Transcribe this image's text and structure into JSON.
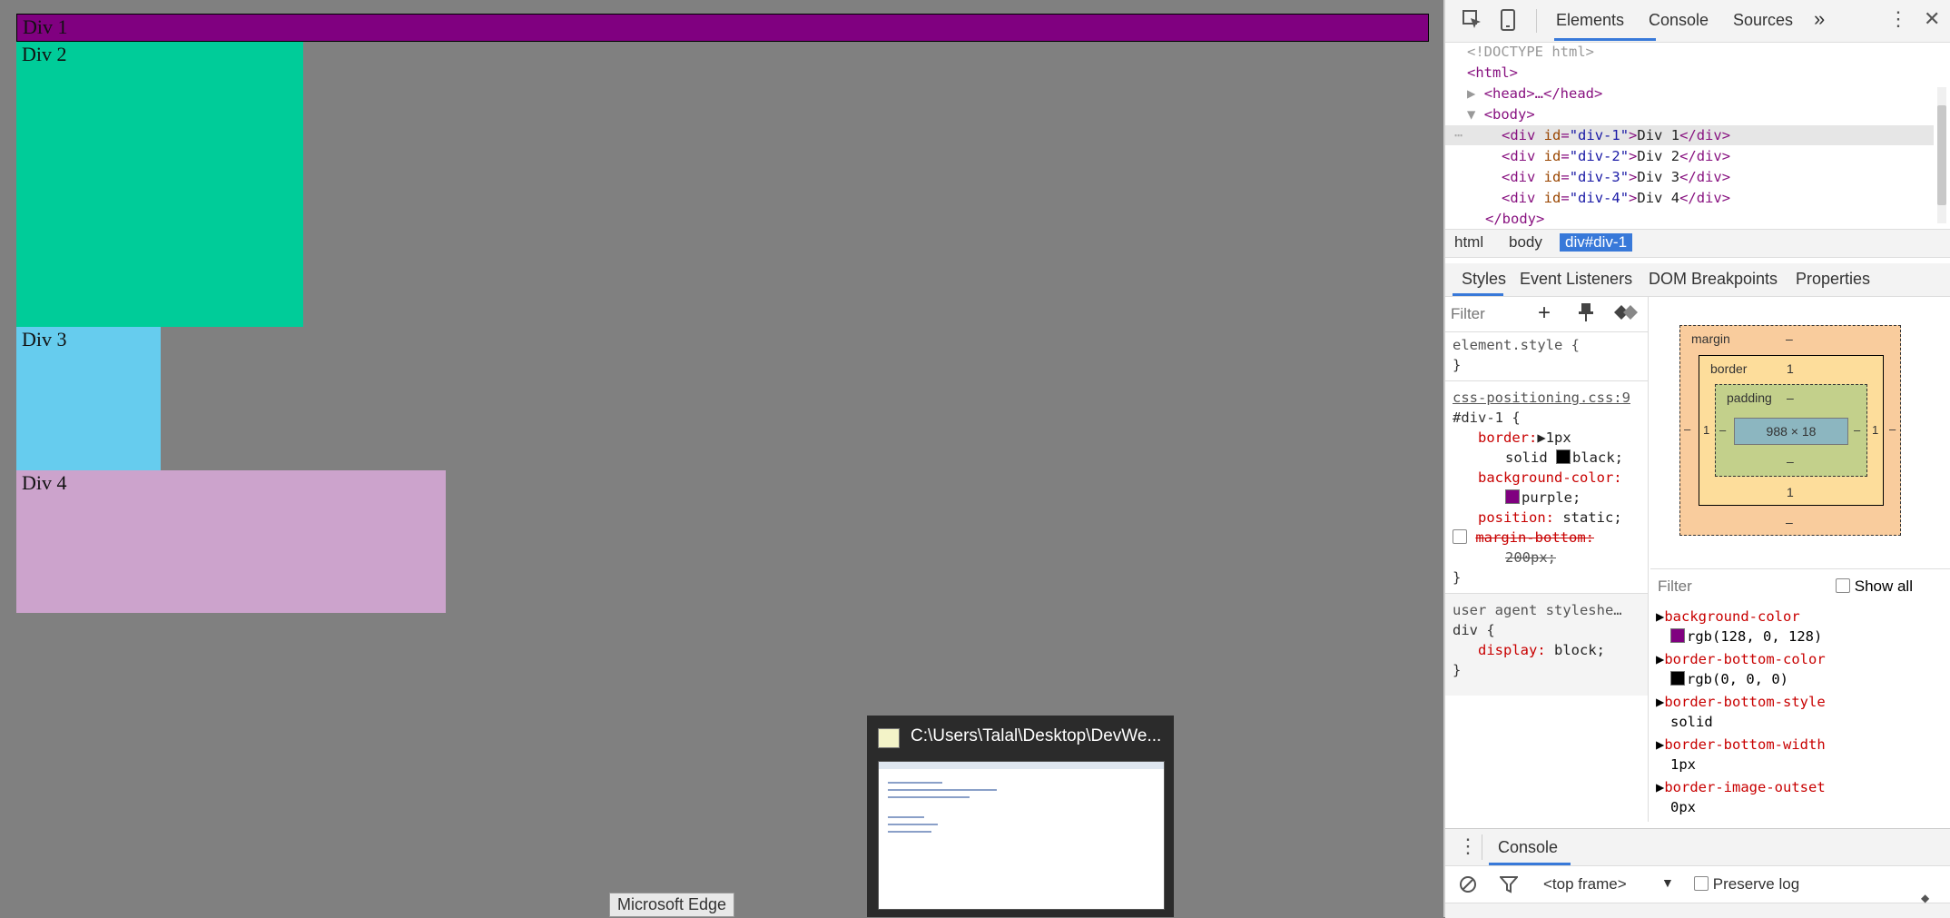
{
  "page": {
    "divs": [
      "Div 1",
      "Div 2",
      "Div 3",
      "Div 4"
    ],
    "taskbar_preview_title": "C:\\Users\\Talal\\Desktop\\DevWe...",
    "tooltip": "Microsoft Edge"
  },
  "devtools": {
    "tabs": [
      "Elements",
      "Console",
      "Sources"
    ],
    "more_tabs": "»",
    "elements_tree": {
      "doctype": "<!DOCTYPE html>",
      "html_open": "<html>",
      "head": "<head>…</head>",
      "body_open": "<body>",
      "divs": [
        {
          "id": "div-1",
          "text": "Div 1"
        },
        {
          "id": "div-2",
          "text": "Div 2"
        },
        {
          "id": "div-3",
          "text": "Div 3"
        },
        {
          "id": "div-4",
          "text": "Div 4"
        }
      ],
      "body_close": "</body>"
    },
    "breadcrumbs": [
      "html",
      "body",
      "div#div-1"
    ],
    "subtabs": [
      "Styles",
      "Event Listeners",
      "DOM Breakpoints",
      "Properties"
    ],
    "styles": {
      "filter_placeholder": "Filter",
      "element_style": "element.style {",
      "close_brace": "}",
      "source": "css-positioning.css:9",
      "selector": "#div-1 {",
      "border_prop": "border:",
      "border_val1": "1px",
      "border_val2": "solid",
      "border_val3": "black;",
      "bg_prop": "background-color:",
      "bg_val": "purple;",
      "pos_prop": "position:",
      "pos_val": "static;",
      "margin_prop": "margin-bottom:",
      "margin_val": "200px;",
      "ua_label": "user agent styleshe…",
      "ua_selector": "div {",
      "ua_prop": "display:",
      "ua_val": "block;"
    },
    "box_model": {
      "margin_label": "margin",
      "margin_dash": "–",
      "border_label": "border",
      "border_val": "1",
      "padding_label": "padding",
      "padding_dash": "–",
      "content": "988 × 18",
      "side_left": "1",
      "side_right": "1",
      "bottom_border": "1",
      "bottom_padding": "–",
      "bottom_margin": "–"
    },
    "computed": {
      "filter_placeholder": "Filter",
      "show_all": "Show all",
      "props": [
        {
          "name": "background-color",
          "value": "rgb(128, 0, 128)",
          "swatch": "#800080"
        },
        {
          "name": "border-bottom-color",
          "value": "rgb(0, 0, 0)",
          "swatch": "#000000"
        },
        {
          "name": "border-bottom-style",
          "value": "solid"
        },
        {
          "name": "border-bottom-width",
          "value": "1px"
        },
        {
          "name": "border-image-outset",
          "value": "0px"
        }
      ]
    },
    "drawer": {
      "tab": "Console",
      "frame": "<top frame>",
      "preserve_log": "Preserve log"
    }
  }
}
